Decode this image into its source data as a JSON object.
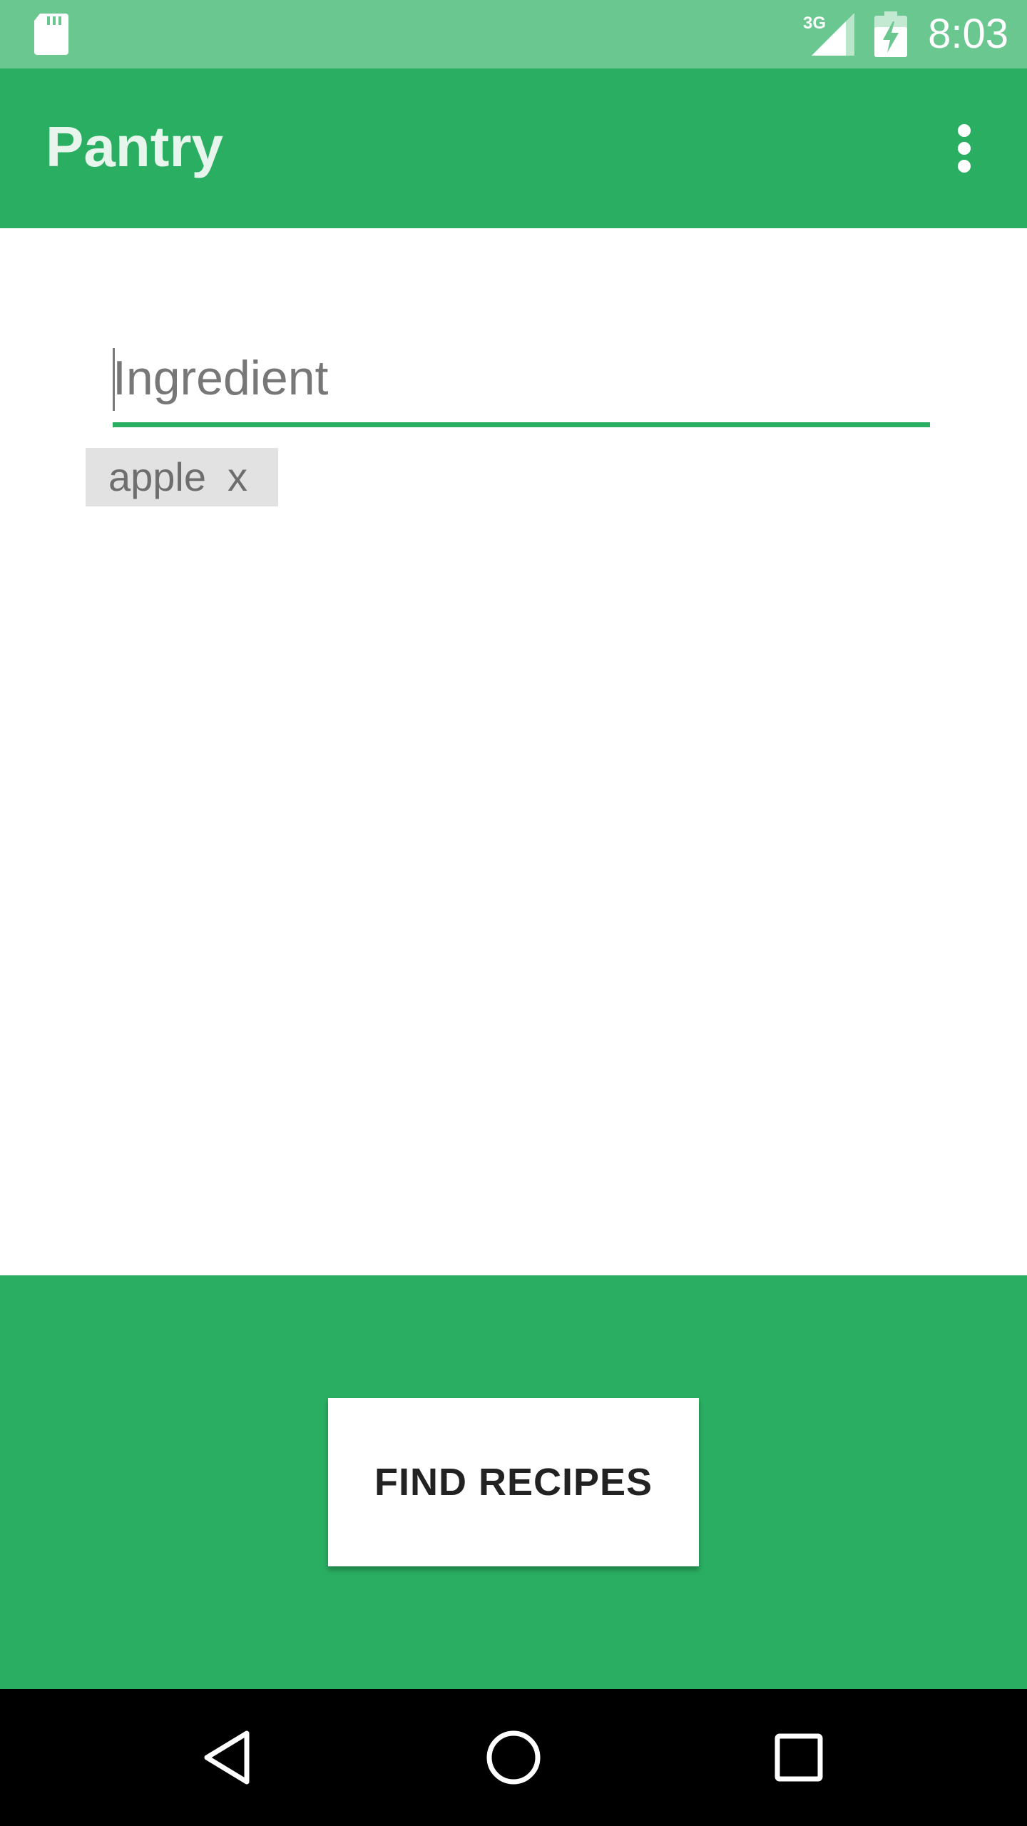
{
  "status_bar": {
    "time": "8:03",
    "network": "3G",
    "icons": [
      "sd-card-icon",
      "signal-3g-icon",
      "battery-charging-icon"
    ]
  },
  "app_bar": {
    "title": "Pantry",
    "menu_icon": "more-vert-icon"
  },
  "ingredient_input": {
    "placeholder": "Ingredient",
    "value": ""
  },
  "chips": [
    {
      "label": "apple",
      "remove": "x"
    }
  ],
  "actions": {
    "find_recipes_label": "FIND RECIPES"
  },
  "nav_bar": {
    "icons": [
      "back-icon",
      "home-icon",
      "recents-icon"
    ]
  },
  "colors": {
    "status_bar": "#69c78f",
    "primary": "#2aae62",
    "chip_bg": "#e2e2e2",
    "nav_bar": "#000000",
    "button_bg": "#ffffff"
  }
}
